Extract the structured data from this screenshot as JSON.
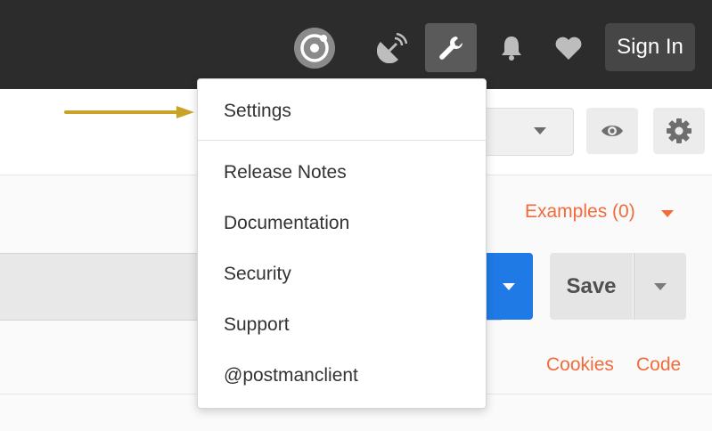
{
  "topbar": {
    "sign_in_label": "Sign In",
    "icons": [
      "sync-icon",
      "satellite-icon",
      "wrench-icon",
      "bell-icon",
      "heart-icon"
    ]
  },
  "menu": {
    "items": [
      "Settings",
      "Release Notes",
      "Documentation",
      "Security",
      "Support",
      "@postmanclient"
    ]
  },
  "builder": {
    "examples_label": "Examples (0)",
    "save_label": "Save",
    "cookies_label": "Cookies",
    "code_label": "Code"
  },
  "colors": {
    "topbar_bg": "#2c2c2c",
    "accent_orange": "#f26b3a",
    "send_blue": "#1f7ae6",
    "annotation_arrow": "#c9a227"
  }
}
